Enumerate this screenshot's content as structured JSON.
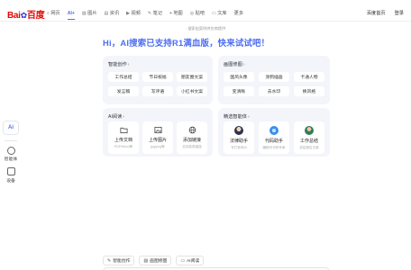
{
  "logo": {
    "part1": "Bai",
    "paw": "✿",
    "part2": "百度"
  },
  "nav": {
    "tabs": [
      {
        "icon": "search-icon",
        "glyph": "⌕",
        "label": "网页"
      },
      {
        "icon": "ai-icon",
        "glyph": "",
        "label": "AI+"
      },
      {
        "icon": "image-icon",
        "glyph": "▨",
        "label": "图片"
      },
      {
        "icon": "news-icon",
        "glyph": "▤",
        "label": "资讯"
      },
      {
        "icon": "video-icon",
        "glyph": "▶",
        "label": "视频"
      },
      {
        "icon": "note-icon",
        "glyph": "✎",
        "label": "笔记"
      },
      {
        "icon": "map-icon",
        "glyph": "⌖",
        "label": "地图"
      },
      {
        "icon": "tieba-icon",
        "glyph": "◎",
        "label": "贴吧"
      },
      {
        "icon": "doc-icon",
        "glyph": "▭",
        "label": "文库"
      },
      {
        "icon": "",
        "glyph": "",
        "label": "更多"
      }
    ],
    "right": {
      "home_label": "百度首页",
      "login_label": "登录"
    }
  },
  "side": {
    "ai_label": "Ai",
    "agent_label": "智能体",
    "device_label": "设备"
  },
  "notice": "· 搜索由案例供应商提供",
  "headline": "Hi，AI搜索已支持R1满血版，快来试试吧！",
  "writing": {
    "title": "智能创作",
    "items": [
      "工作总结",
      "节日祝福",
      "朋友圈文案",
      "发言稿",
      "写评语",
      "小红书文案"
    ]
  },
  "painting": {
    "title": "画图修图",
    "items": [
      "国风头像",
      "涂鸦插画",
      "卡通人物",
      "变清晰",
      "去水印",
      "换风格"
    ]
  },
  "reading": {
    "title": "AI阅读",
    "items": [
      {
        "label": "上传文档",
        "sub": "PDF/Word等"
      },
      {
        "label": "上传图片",
        "sub": "jpg/png等"
      },
      {
        "label": "添加链接",
        "sub": "支持各类链接"
      }
    ]
  },
  "agents": {
    "title": "精选智能体",
    "items": [
      {
        "label": "法律助手",
        "sub": "专打官司AI"
      },
      {
        "label": "代码助手",
        "sub": "编程写代码专家"
      },
      {
        "label": "工作总结",
        "sub": "总结报告文案"
      }
    ]
  },
  "chips": [
    {
      "icon": "✎",
      "label": "智能创作"
    },
    {
      "icon": "▨",
      "label": "画图修图"
    },
    {
      "icon": "▭",
      "label": "AI阅读"
    }
  ],
  "colors": {
    "accent": "#4e6ef2",
    "brand_red": "#e10601",
    "card_bg": "#f3f5fb"
  }
}
